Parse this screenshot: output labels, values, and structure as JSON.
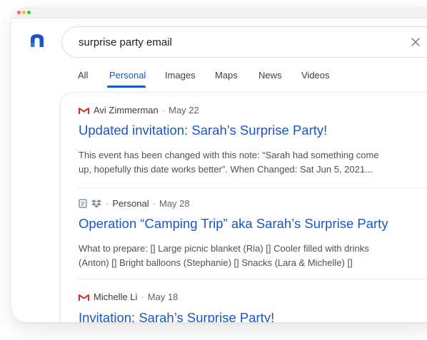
{
  "window": {
    "controls": [
      "close",
      "minimize",
      "zoom"
    ],
    "colors": {
      "close": "#f5655b",
      "minimize": "#f8bc3b",
      "zoom": "#3bc43f"
    }
  },
  "logo": {
    "icon": "app-logo-icon",
    "color": "#1a56c7"
  },
  "search": {
    "query": "surprise party email",
    "clear_icon": "close-icon"
  },
  "tabs": [
    {
      "label": "All",
      "active": false
    },
    {
      "label": "Personal",
      "active": true
    },
    {
      "label": "Images",
      "active": false
    },
    {
      "label": "Maps",
      "active": false
    },
    {
      "label": "News",
      "active": false
    },
    {
      "label": "Videos",
      "active": false
    }
  ],
  "accent_color": "#1a56c7",
  "results": [
    {
      "source_icon": "gmail-icon",
      "sender": "Avi Zimmerman",
      "separator": "·",
      "date": "May 22",
      "title": "Updated invitation: Sarah’s Surprise Party!",
      "snippet_line1": "This event has been changed with this note: “Sarah had something come",
      "snippet_line2": "up, hopefully this date works better”. When Changed: Sat Jun 5, 2021..."
    },
    {
      "source_icons": [
        "docs-icon",
        "dropbox-icon"
      ],
      "sender": "Personal",
      "separator": "·",
      "date": "May 28",
      "title": "Operation “Camping Trip” aka Sarah’s Surprise Party",
      "snippet_line1": "What to prepare: [] Large picnic blanket (Ria) [] Cooler filled with drinks",
      "snippet_line2": "(Anton) [] Bright balloons (Stephanie) [] Snacks (Lara & Michelle) []"
    },
    {
      "source_icon": "gmail-icon",
      "sender": "Michelle Li",
      "separator": "·",
      "date": "May 18",
      "title": "Invitation: Sarah’s Surprise Party!"
    }
  ]
}
